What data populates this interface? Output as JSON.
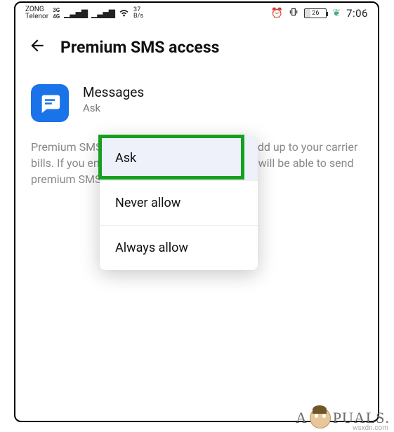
{
  "status": {
    "carrier1": "ZONG",
    "carrier2": "Telenor",
    "net1": "3G",
    "net2": "4G",
    "data_rate_top": "37",
    "data_rate_unit": "B/s",
    "battery_pct": "26",
    "time": "7:06"
  },
  "header": {
    "title": "Premium SMS access"
  },
  "app": {
    "name": "Messages",
    "status": "Ask"
  },
  "description": "Premium SMS may cost you money and will add up to your carrier bills. If you enable permission for an app, you will be able to send premium SMS using that app.",
  "dropdown": {
    "options": [
      {
        "label": "Ask",
        "selected": true
      },
      {
        "label": "Never allow",
        "selected": false
      },
      {
        "label": "Always allow",
        "selected": false
      }
    ]
  },
  "watermark": {
    "brand_left": "A",
    "brand_right": "PUALS.",
    "url": "wsxdn.com"
  }
}
